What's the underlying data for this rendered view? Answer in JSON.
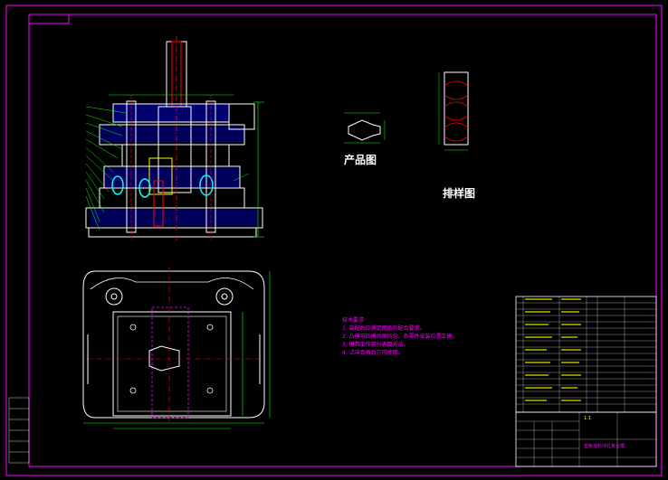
{
  "drawing": {
    "captions": {
      "product": "产品图",
      "strip_layout": "排样图"
    },
    "tech_notes": {
      "title": "技术要求",
      "items": [
        "1. 装配后应满足图纸的配合要求。",
        "2. 凸模与凹模间隙均匀，各零件安装位置正确。",
        "3. 模具工作部分表面光洁。",
        "4. 试冲合格后方可使用。"
      ]
    },
    "title_block": {
      "drawing_name": "垫板落料冲孔复合模",
      "scale": "1:1"
    },
    "colors": {
      "background": "#000000",
      "frame": "#ff00ff",
      "outline": "#ffffff",
      "centerline": "#ff0000",
      "dimension": "#00ff00",
      "hidden": "#ffff00",
      "hatch": "#0000ff",
      "accent": "#00ffff"
    }
  }
}
